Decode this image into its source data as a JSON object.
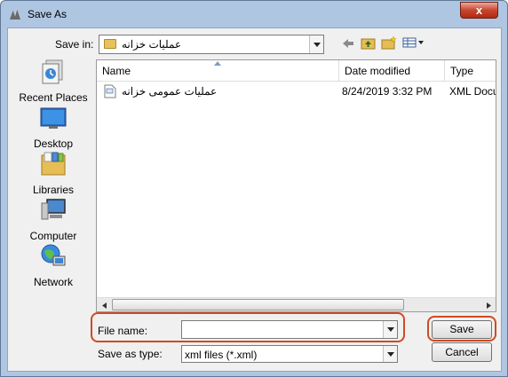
{
  "window": {
    "title": "Save As",
    "close_glyph": "x"
  },
  "toolbar": {
    "save_in_label": "Save in:",
    "save_in_value": "عمليات خزانه",
    "icons": [
      "back-arrow-icon",
      "up-folder-icon",
      "new-folder-icon",
      "view-menu-icon"
    ]
  },
  "places": [
    {
      "label": "Recent Places",
      "icon": "recent-places-icon"
    },
    {
      "label": "Desktop",
      "icon": "desktop-icon"
    },
    {
      "label": "Libraries",
      "icon": "libraries-icon"
    },
    {
      "label": "Computer",
      "icon": "computer-icon"
    },
    {
      "label": "Network",
      "icon": "network-icon"
    }
  ],
  "file_list": {
    "columns": [
      "Name",
      "Date modified",
      "Type"
    ],
    "rows": [
      {
        "name": "عمليات عمومی خزانه",
        "date": "8/24/2019 3:32 PM",
        "type": "XML Docu"
      }
    ]
  },
  "form": {
    "file_name_label": "File name:",
    "file_name_value": "",
    "save_as_type_label": "Save as type:",
    "save_as_type_value": "xml files (*.xml)"
  },
  "buttons": {
    "save": "Save",
    "cancel": "Cancel"
  },
  "colors": {
    "highlight": "#d04a22",
    "title_bar": "#aec6e2",
    "close": "#c7452d"
  }
}
